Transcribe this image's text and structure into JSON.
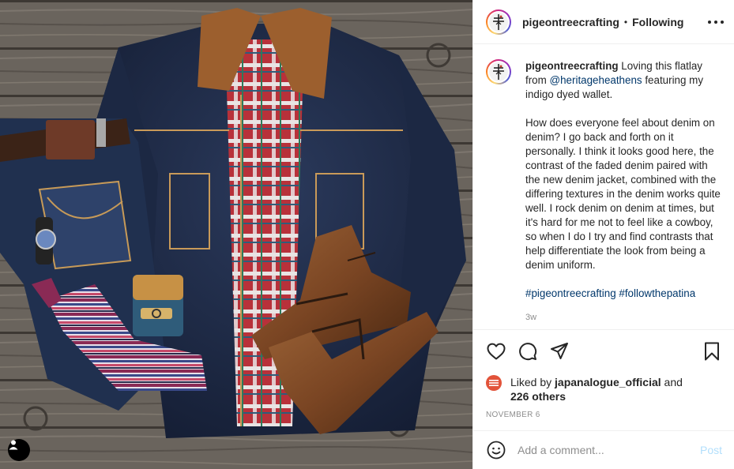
{
  "header": {
    "username": "pigeontreecrafting",
    "separator": "•",
    "follow_label": "Following"
  },
  "caption": {
    "username": "pigeontreecrafting",
    "intro": " Loving this flatlay from ",
    "mention": "@heritageheathens",
    "intro_end": " featuring my indigo dyed wallet.",
    "body": "How does everyone feel about denim on denim? I go back and forth on it personally. I think it looks good here, the contrast of the faded denim paired with the new denim jacket, combined with the differing textures in the denim works quite well. I rock denim on denim at times, but it's hard for me not to feel like a cowboy, so when I do I try and find contrasts that help differentiate the look from being a denim uniform.",
    "hashtag_1": "#pigeontreecrafting",
    "hashtag_2": "#followthepatina",
    "time_ago": "3w"
  },
  "likes": {
    "prefix": "Liked by ",
    "user": "japanalogue_official",
    "and": " and",
    "others": "226 others"
  },
  "date": "NOVEMBER 6",
  "comment": {
    "placeholder": "Add a comment...",
    "post_label": "Post"
  },
  "icons": {
    "like": "heart-icon",
    "comment": "comment-bubble-icon",
    "share": "paper-plane-icon",
    "save": "bookmark-icon",
    "more": "more-dots-icon",
    "emoji": "smiley-icon",
    "tag": "user-tag-icon"
  },
  "colors": {
    "link": "#00376b",
    "muted": "#8e8e8e",
    "post_button": "#b2dffc",
    "border": "#efefef"
  }
}
